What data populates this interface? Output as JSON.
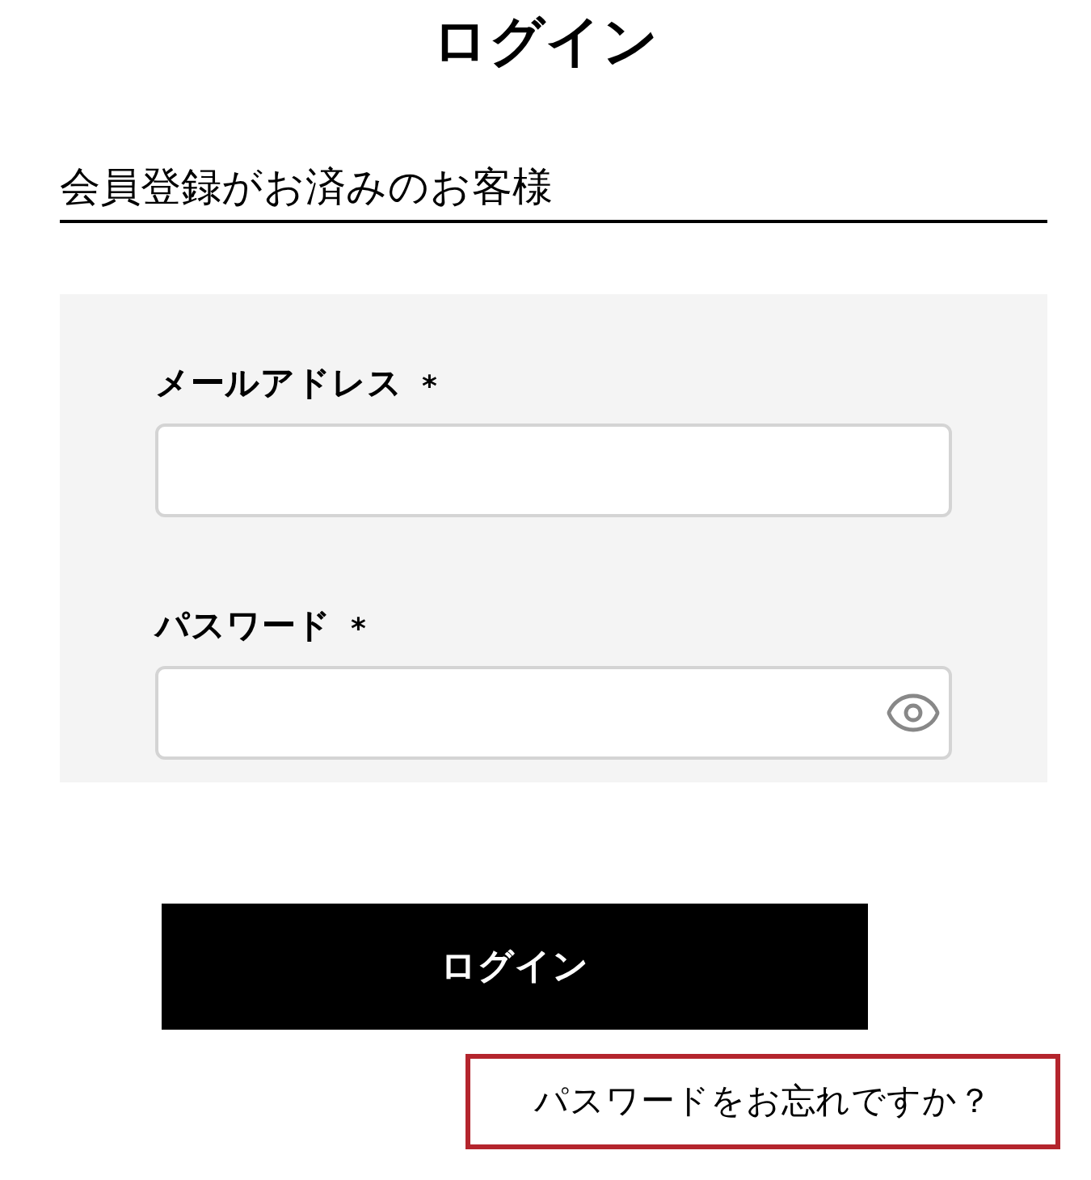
{
  "title": "ログイン",
  "section_heading": "会員登録がお済みのお客様",
  "fields": [
    {
      "label": "メールアドレス",
      "required_mark": "*",
      "kind": "text"
    },
    {
      "label": "パスワード",
      "required_mark": "*",
      "kind": "password"
    }
  ],
  "submit_button": "ログイン",
  "forgot_link": {
    "text": "パスワードをお忘れですか？",
    "highlighted": true
  }
}
